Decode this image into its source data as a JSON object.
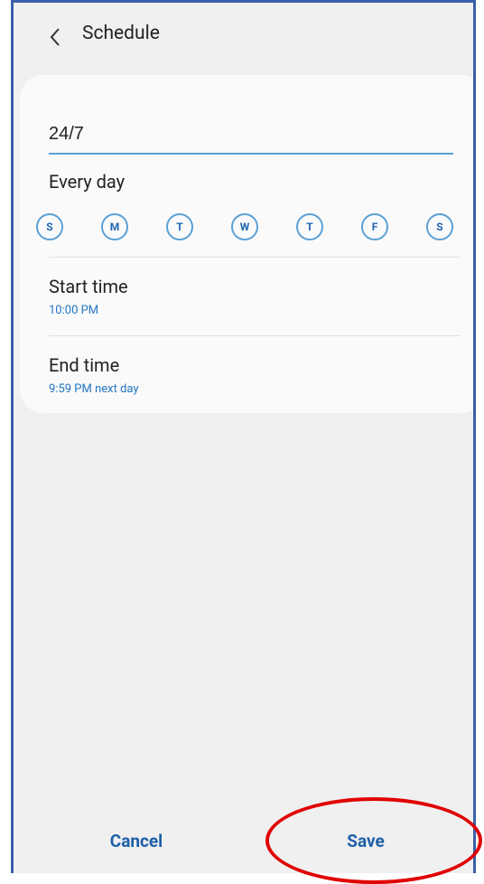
{
  "header": {
    "title": "Schedule",
    "back_icon": "chevron-left-icon"
  },
  "schedule": {
    "name_value": "24/7",
    "repeat_label": "Every day",
    "days": [
      "S",
      "M",
      "T",
      "W",
      "T",
      "F",
      "S"
    ],
    "start_time_label": "Start time",
    "start_time_value": "10:00 PM",
    "end_time_label": "End time",
    "end_time_value": "9:59 PM next day"
  },
  "footer": {
    "cancel_label": "Cancel",
    "save_label": "Save"
  },
  "colors": {
    "accent": "#1e66b3",
    "link": "#2276c4",
    "highlight": "#e00000",
    "frame": "#3b5fa8"
  }
}
